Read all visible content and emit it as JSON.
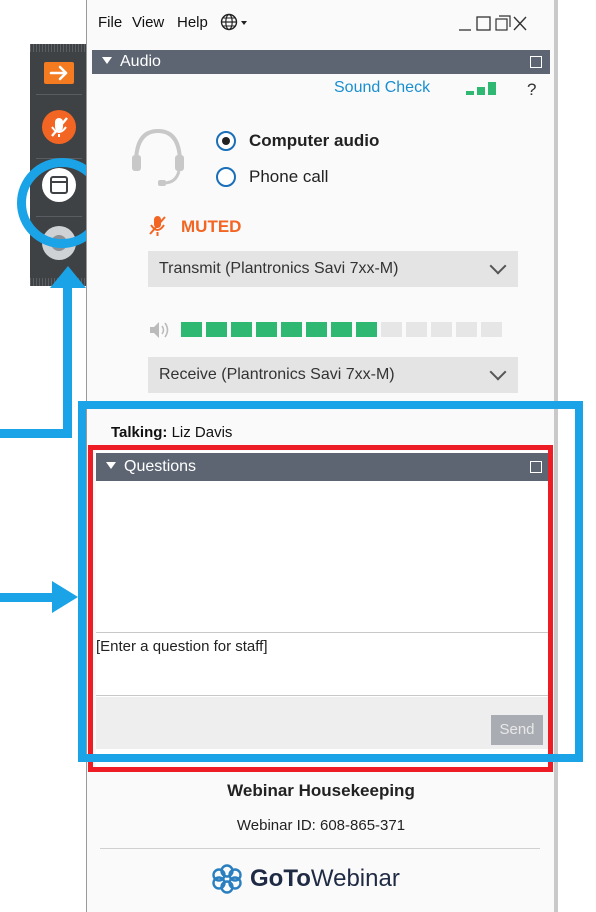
{
  "menu": {
    "file": "File",
    "view": "View",
    "help": "Help"
  },
  "audio": {
    "title": "Audio",
    "sound_check": "Sound Check",
    "help_q": "?",
    "computer_audio": "Computer audio",
    "phone_call": "Phone call",
    "selected": "Computer audio",
    "muted": "MUTED",
    "transmit": "Transmit (Plantronics Savi 7xx-M)",
    "receive": "Receive (Plantronics Savi 7xx-M)",
    "level_active_bars": 8,
    "level_total_bars": 13
  },
  "talking": {
    "label": "Talking:",
    "name": "Liz Davis"
  },
  "questions": {
    "title": "Questions",
    "input_placeholder": "[Enter a question for staff]",
    "send": "Send"
  },
  "footer": {
    "title": "Webinar Housekeeping",
    "webinar_id": "Webinar ID: 608-865-371",
    "brand_bold": "GoTo",
    "brand_light": "Webinar"
  },
  "colors": {
    "accent_blue": "#1aa3e6",
    "highlight_red": "#ee1c24",
    "header_bar": "#5d6573",
    "muted_orange": "#f26522",
    "level_green": "#2eb872",
    "link_blue": "#1a8fd0"
  }
}
